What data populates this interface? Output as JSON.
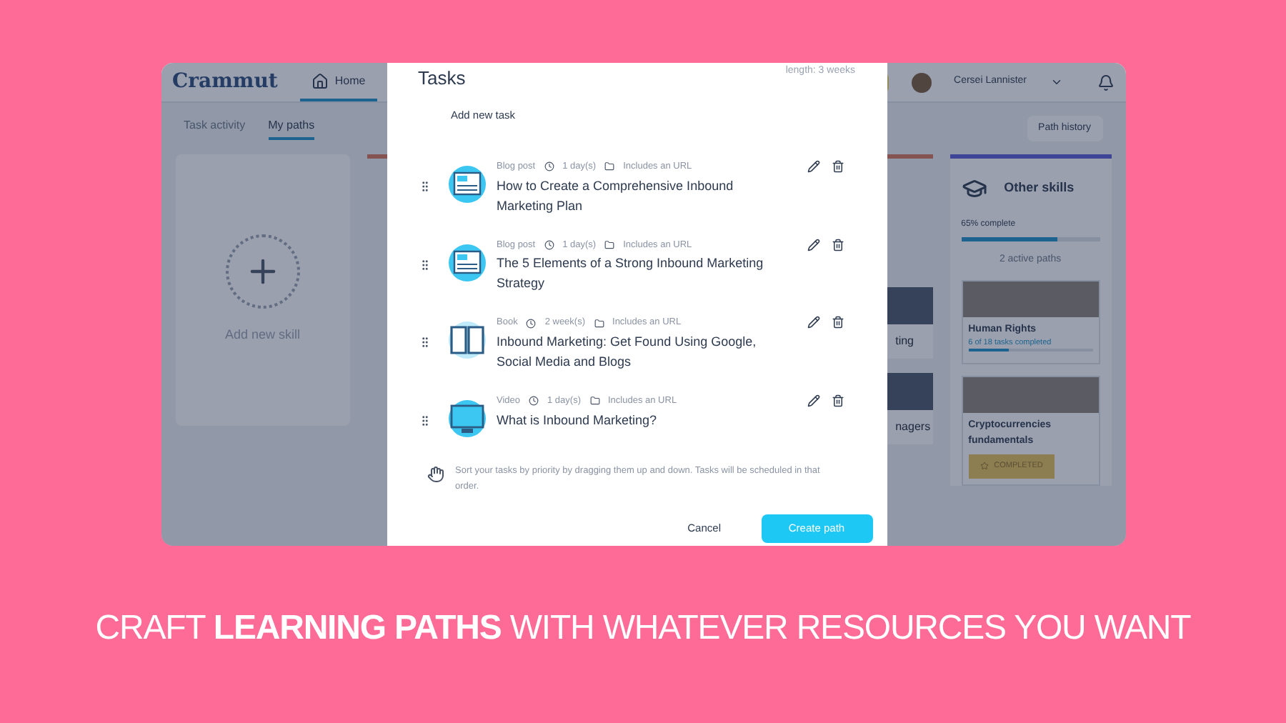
{
  "app": {
    "logo": "Crammut",
    "nav": [
      {
        "label": "Home",
        "selected": true
      }
    ],
    "user": {
      "name": "Cersei Lannister"
    },
    "tabs": [
      {
        "label": "Task activity",
        "selected": false
      },
      {
        "label": "My paths",
        "selected": true
      }
    ],
    "path_history_button": "Path history",
    "add_skill": {
      "label": "Add new skill"
    },
    "column_2": {
      "cards": [
        {
          "title": "ting"
        },
        {
          "title": "nagers"
        }
      ]
    },
    "other_skills": {
      "title": "Other skills",
      "progress_label": "65% complete",
      "level": 0.7,
      "active_paths": "2 active paths",
      "paths": [
        {
          "title": "Human Rights",
          "subtitle": "6 of 18 tasks completed",
          "level": 0.33,
          "completed": false
        },
        {
          "title": "Cryptocurrencies fundamentals",
          "completed": true,
          "badge": "COMPLETED"
        }
      ]
    }
  },
  "modal": {
    "title": "Tasks",
    "length": "length: 3 weeks",
    "add_task": "Add new task",
    "tasks": [
      {
        "kind": "blog",
        "type": "Blog post",
        "duration": "1 day(s)",
        "resource": "Includes an URL",
        "title": "How to Create a Comprehensive Inbound Marketing Plan"
      },
      {
        "kind": "blog",
        "type": "Blog post",
        "duration": "1 day(s)",
        "resource": "Includes an URL",
        "title": "The 5 Elements of a Strong Inbound Marketing Strategy"
      },
      {
        "kind": "book",
        "type": "Book",
        "duration": "2 week(s)",
        "resource": "Includes an URL",
        "title": "Inbound Marketing: Get Found Using Google, Social Media and Blogs"
      },
      {
        "kind": "video",
        "type": "Video",
        "duration": "1 day(s)",
        "resource": "Includes an URL",
        "title": "What is Inbound Marketing?"
      }
    ],
    "hint": "Sort your tasks by priority by dragging them up and down. Tasks will be scheduled in that order.",
    "cancel": "Cancel",
    "create": "Create path"
  },
  "caption": "CRAFT **LEARNING PATHS** WITH WHATEVER RESOURCES YOU WANT"
}
